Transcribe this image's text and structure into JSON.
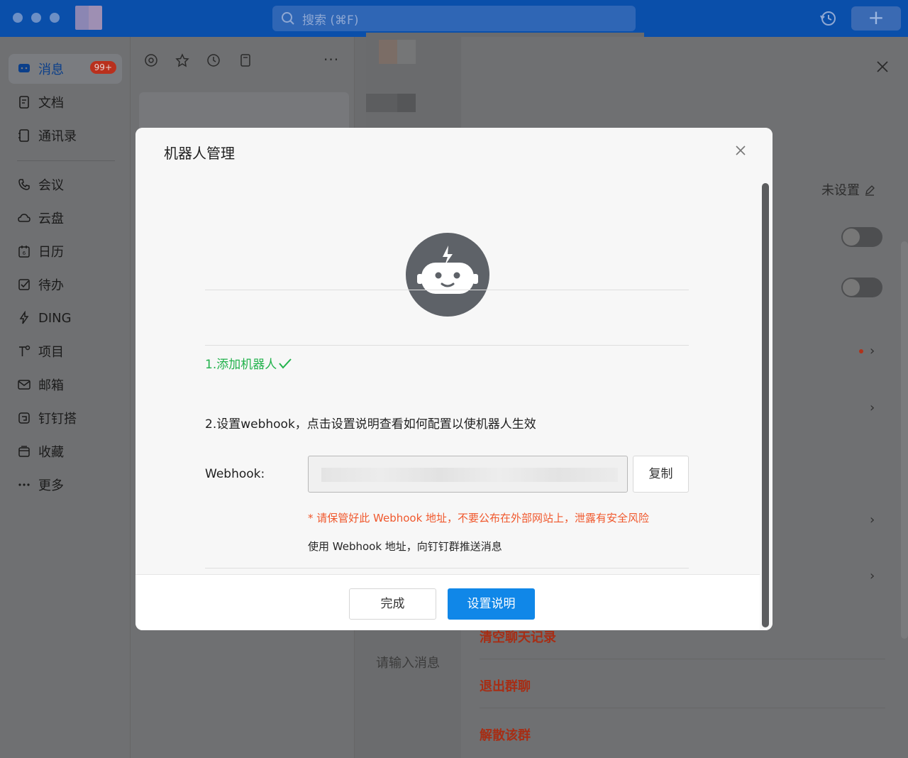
{
  "titlebar": {
    "search_placeholder": "搜索 (⌘F)",
    "plus_label": "+"
  },
  "nav": {
    "items": [
      {
        "label": "消息",
        "icon": "chat-bubble-icon",
        "badge": "99+"
      },
      {
        "label": "文档",
        "icon": "document-icon"
      },
      {
        "label": "通讯录",
        "icon": "contacts-icon"
      },
      {
        "label": "会议",
        "icon": "phone-icon"
      },
      {
        "label": "云盘",
        "icon": "cloud-icon"
      },
      {
        "label": "日历",
        "icon": "calendar-icon"
      },
      {
        "label": "待办",
        "icon": "todo-check-icon"
      },
      {
        "label": "DING",
        "icon": "lightning-icon"
      },
      {
        "label": "项目",
        "icon": "project-icon"
      },
      {
        "label": "邮箱",
        "icon": "mail-icon"
      },
      {
        "label": "钉钉搭",
        "icon": "builder-icon"
      },
      {
        "label": "收藏",
        "icon": "favorites-icon"
      },
      {
        "label": "更多",
        "icon": "more-dots-icon"
      }
    ]
  },
  "chatlist": {
    "more_label": "···"
  },
  "middle": {
    "input_placeholder": "请输入消息"
  },
  "settings": {
    "unset_label": "未设置",
    "clear_history": "清空聊天记录",
    "leave_group": "退出群聊",
    "dissolve_group": "解散该群"
  },
  "modal": {
    "title": "机器人管理",
    "step1": "1.添加机器人",
    "step2": "2.设置webhook，点击设置说明查看如何配置以使机器人生效",
    "webhook_label": "Webhook:",
    "copy_button": "复制",
    "warning": "* 请保管好此 Webhook 地址，不要公布在外部网站上，泄露有安全风险",
    "usage": "使用 Webhook 地址，向钉钉群推送消息",
    "done_button": "完成",
    "guide_button": "设置说明"
  },
  "colors": {
    "titlebar": "#0a4faa",
    "primary_button": "#1087e8",
    "success": "#22b24c",
    "warning": "#f0582d",
    "danger": "#a72d14"
  }
}
